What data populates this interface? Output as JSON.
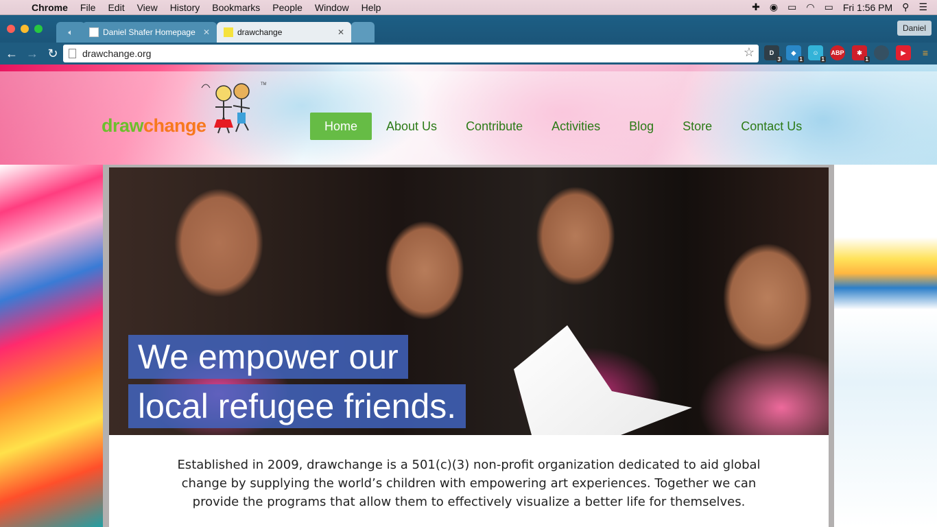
{
  "menubar": {
    "app": "Chrome",
    "items": [
      "File",
      "Edit",
      "View",
      "History",
      "Bookmarks",
      "People",
      "Window",
      "Help"
    ],
    "clock": "Fri 1:56 PM"
  },
  "browser": {
    "tabs": [
      {
        "title": "Daniel Shafer Homepage"
      },
      {
        "title": "drawchange"
      }
    ],
    "profile": "Daniel",
    "url": "drawchange.org",
    "extensions": [
      {
        "icon": "dollar-ext-icon",
        "badge": "3",
        "color": "#2f3e48"
      },
      {
        "icon": "puzzle-ext-icon",
        "badge": "1",
        "color": "#2a88c8"
      },
      {
        "icon": "ghost-ext-icon",
        "badge": "1",
        "color": "#33b3d8"
      },
      {
        "icon": "adblock-ext-icon",
        "badge": "ABP",
        "color": "#cf2027"
      },
      {
        "icon": "lastpass-ext-icon",
        "badge": "1",
        "color": "#cf1f2a"
      },
      {
        "icon": "dark-mode-ext-icon",
        "badge": "",
        "color": "#355062"
      },
      {
        "icon": "youtube-ext-icon",
        "badge": "",
        "color": "#e3202f"
      },
      {
        "icon": "menu-icon",
        "badge": "",
        "color": "#e5a030"
      }
    ]
  },
  "site": {
    "logo": {
      "part1": "draw",
      "part2": "change"
    },
    "nav": [
      "Home",
      "About Us",
      "Contribute",
      "Activities",
      "Blog",
      "Store",
      "Contact Us"
    ],
    "active_nav": "Home",
    "tagline": {
      "line1": "We empower our",
      "line2": "local refugee friends."
    },
    "intro": "Established in 2009, drawchange is a 501(c)(3) non-profit organization dedicated to aid global change by supplying the world’s children with empowering art experiences. Together we can provide the programs that allow them to effectively visualize a better life for themselves."
  }
}
